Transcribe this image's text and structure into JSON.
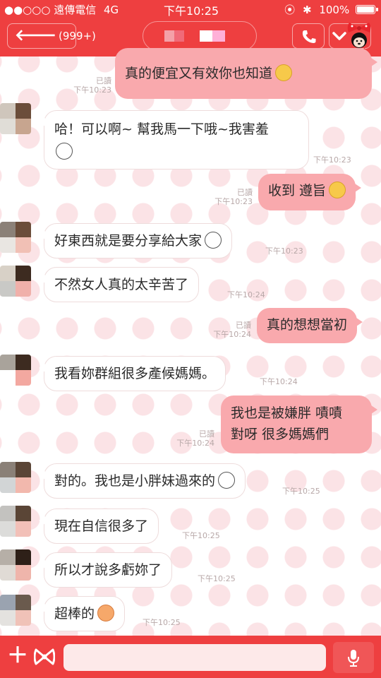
{
  "status_bar": {
    "carrier": "●●○○○ 遠傳電信",
    "network": "4G",
    "time": "下午10:25",
    "battery": "100%"
  },
  "header": {
    "back_count": "(999+)",
    "colors": {
      "bar": "#ee3f40"
    }
  },
  "messages": [
    {
      "side": "out",
      "text": "真的便宜又有效你也知道",
      "read": "已讀",
      "time": "下午10:23",
      "emoji": "crying-face"
    },
    {
      "side": "in",
      "lines": [
        "哈！可以啊~ 幫我馬一下哦~我害羞"
      ],
      "time": "下午10:23",
      "emoji": "shy-face"
    },
    {
      "side": "out",
      "text": "收到 遵旨",
      "read": "已讀",
      "time": "下午10:23",
      "emoji": "smiling-face"
    },
    {
      "side": "in",
      "text": "好東西就是要分享給大家",
      "time": "下午10:23",
      "emoji": "grinning-face"
    },
    {
      "side": "in",
      "text": "不然女人真的太辛苦了",
      "time": "下午10:24"
    },
    {
      "side": "out",
      "text": "真的想想當初",
      "read": "已讀",
      "time": "下午10:24"
    },
    {
      "side": "in",
      "text": "我看妳群組很多產候媽媽。",
      "time": "下午10:24"
    },
    {
      "side": "out",
      "lines": [
        "我也是被嫌胖 嘖嘖",
        "對呀 很多媽媽們"
      ],
      "read": "已讀",
      "time": "下午10:24"
    },
    {
      "side": "in",
      "text": "對的。我也是小胖妹過來的",
      "time": "下午10:25",
      "emoji": "laughing-face"
    },
    {
      "side": "in",
      "text": "現在自信很多了",
      "time": "下午10:25"
    },
    {
      "side": "in",
      "text": "所以才說多虧妳了",
      "time": "下午10:25"
    },
    {
      "side": "in",
      "text": "超棒的",
      "time": "下午10:25",
      "emoji": "kiss-face"
    }
  ],
  "input_bar": {
    "placeholder": ""
  }
}
